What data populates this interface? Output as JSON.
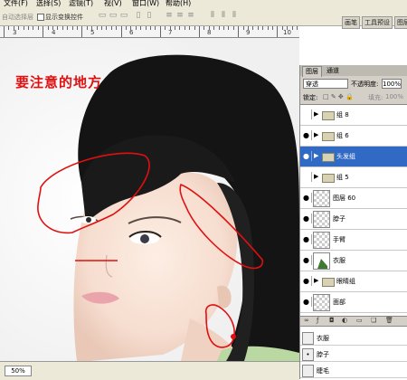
{
  "menubar": {
    "items": [
      "文件(F)",
      "选择(S)",
      "滤镜(T)",
      "视(V)",
      "窗口(W)",
      "帮助(H)"
    ]
  },
  "options": {
    "auto_select": "自动选择层",
    "show_transform": "显示变换控件"
  },
  "panel_tabs": [
    "画笔",
    "工具预设",
    "图层复合"
  ],
  "ruler": {
    "numbers": [
      "3",
      "4",
      "5",
      "6",
      "7",
      "8",
      "9",
      "10"
    ]
  },
  "annotation": {
    "text": "要注意的地方",
    "color": "#e01010"
  },
  "status": {
    "zoom": "50%"
  },
  "layers_panel": {
    "tabs": [
      "图层",
      "通道"
    ],
    "blend_mode": "穿透",
    "opacity_label": "不透明度:",
    "opacity_value": "100%",
    "lock_label": "锁定:",
    "fill_label": "填充:",
    "fill_value": "100%",
    "rows": [
      {
        "name": "组 8",
        "type": "group",
        "visible": false
      },
      {
        "name": "组 6",
        "type": "group",
        "visible": true
      },
      {
        "name": "头发组",
        "type": "group",
        "visible": true,
        "selected": true
      },
      {
        "name": "组 5",
        "type": "group",
        "visible": false
      },
      {
        "name": "图层 60",
        "type": "layer",
        "visible": true
      },
      {
        "name": "脖子",
        "type": "layer",
        "visible": true
      },
      {
        "name": "手臂",
        "type": "layer",
        "visible": true
      },
      {
        "name": "衣服",
        "type": "layer-green",
        "visible": true
      },
      {
        "name": "眼睛组",
        "type": "group",
        "visible": true
      },
      {
        "name": "面部",
        "type": "layer",
        "visible": true
      }
    ],
    "history": [
      {
        "name": "衣服"
      },
      {
        "name": "脖子"
      },
      {
        "name": "睫毛"
      }
    ],
    "selected_color": "#316ac5"
  }
}
